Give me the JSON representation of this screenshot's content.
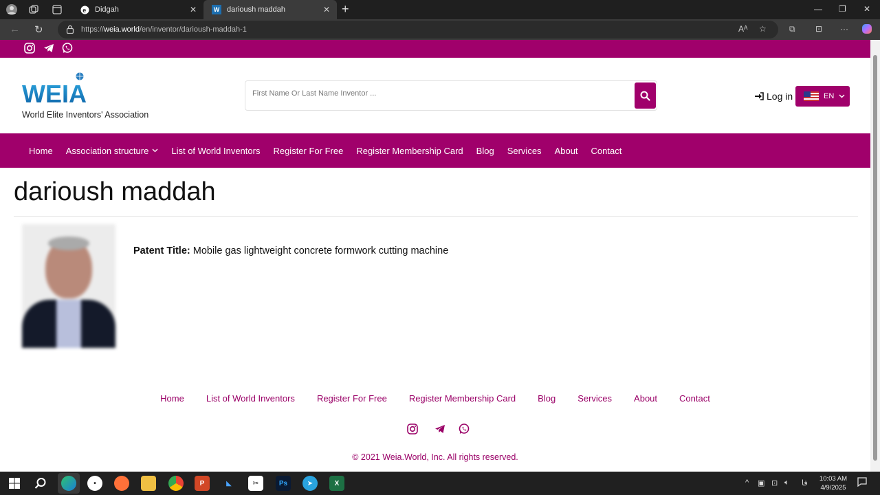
{
  "browser": {
    "tabs": [
      {
        "title": "Didgah",
        "active": false
      },
      {
        "title": "darioush maddah",
        "active": true
      }
    ],
    "url_prefix": "https://",
    "url_host": "weia.world",
    "url_path": "/en/inventor/darioush-maddah-1"
  },
  "site": {
    "logo_text": "WEIA",
    "logo_tagline": "World Elite Inventors' Association",
    "search_placeholder": "First Name Or Last Name Inventor ...",
    "login_label": "Log in",
    "language": "EN",
    "nav": [
      "Home",
      "Association structure",
      "List of World Inventors",
      "Register For Free",
      "Register Membership Card",
      "Blog",
      "Services",
      "About",
      "Contact"
    ]
  },
  "inventor": {
    "name": "darioush maddah",
    "patent_label": "Patent Title:",
    "patent_title": "Mobile gas lightweight concrete formwork cutting machine"
  },
  "footer": {
    "nav": [
      "Home",
      "List of World Inventors",
      "Register For Free",
      "Register Membership Card",
      "Blog",
      "Services",
      "About",
      "Contact"
    ],
    "copyright": "© 2021 Weia.World, Inc. All rights reserved."
  },
  "taskbar": {
    "language_indicator": "فا",
    "time": "10:03 AM",
    "date": "4/9/2025"
  },
  "colors": {
    "brand": "#a0006b",
    "footer_link": "#9a0067"
  }
}
